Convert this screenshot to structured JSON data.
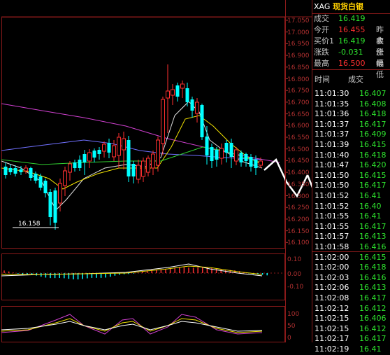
{
  "symbol": "XAG",
  "name": "现货白银",
  "low_marker": "16.158",
  "price_axis": [
    "17.050",
    "17.000",
    "16.950",
    "16.900",
    "16.850",
    "16.800",
    "16.750",
    "16.700",
    "16.650",
    "16.600",
    "16.550",
    "16.500",
    "16.450",
    "16.400",
    "16.350",
    "16.300",
    "16.250",
    "16.200",
    "16.150",
    "16.100"
  ],
  "macd_axis": [
    "0.10",
    "0.00",
    "-0.10"
  ],
  "kdj_axis": [
    "100",
    "50",
    "0"
  ],
  "quote": {
    "last_label": "成交",
    "last_value": "16.419",
    "open_label": "今开",
    "open_value": "16.455",
    "open_ext": "昨收",
    "bid_label": "买价1",
    "bid_value": "16.419",
    "bid_ext": "卖价",
    "chg_label": "涨跌",
    "chg_value": "-0.031",
    "chg_ext": "涨幅",
    "high_label": "最高",
    "high_value": "16.500",
    "high_ext": "最低"
  },
  "ticks_header": {
    "time": "时间",
    "price": "成交"
  },
  "ticks": [
    {
      "time": "11:01:30",
      "price": "16.407"
    },
    {
      "time": "11:01:35",
      "price": "16.408"
    },
    {
      "time": "11:01:36",
      "price": "16.418"
    },
    {
      "time": "11:01:37",
      "price": "16.417"
    },
    {
      "time": "11:01:37",
      "price": "16.409"
    },
    {
      "time": "11:01:39",
      "price": "16.415"
    },
    {
      "time": "11:01:40",
      "price": "16.418"
    },
    {
      "time": "11:01:47",
      "price": "16.420"
    },
    {
      "time": "11:01:50",
      "price": "16.415"
    },
    {
      "time": "11:01:50",
      "price": "16.417"
    },
    {
      "time": "11:01:52",
      "price": "16.41"
    },
    {
      "time": "11:01:52",
      "price": "16.40"
    },
    {
      "time": "11:01:55",
      "price": "16.41"
    },
    {
      "time": "11:01:55",
      "price": "16.417"
    },
    {
      "time": "11:01:57",
      "price": "16.413"
    },
    {
      "time": "11:01:58",
      "price": "16.416"
    },
    {
      "time": "11:02:00",
      "price": "16.415"
    },
    {
      "time": "11:02:00",
      "price": "16.418"
    },
    {
      "time": "11:02:03",
      "price": "16.416"
    },
    {
      "time": "11:02:06",
      "price": "16.413"
    },
    {
      "time": "11:02:08",
      "price": "16.417"
    },
    {
      "time": "11:02:12",
      "price": "16.412"
    },
    {
      "time": "11:02:15",
      "price": "16.406"
    },
    {
      "time": "11:02:15",
      "price": "16.412"
    },
    {
      "time": "11:02:17",
      "price": "16.417"
    },
    {
      "time": "11:02:19",
      "price": "16.41"
    }
  ],
  "colors": {
    "up": "#ff3030",
    "down": "#00ffff",
    "accent": "#ffd000",
    "grid": "#8a1a1a",
    "green": "#2ee62e"
  }
}
